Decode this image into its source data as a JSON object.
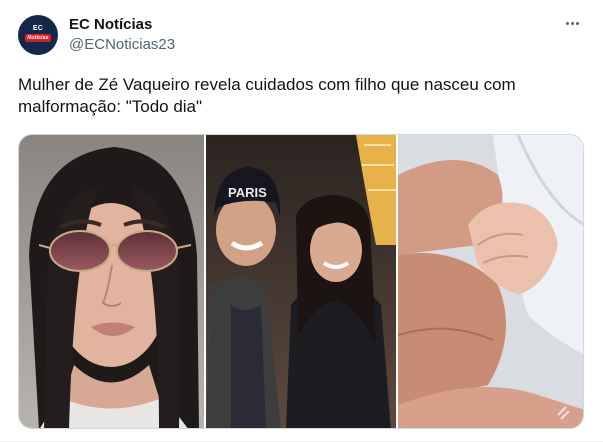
{
  "author": {
    "display_name": "EC Notícias",
    "handle": "@ECNoticias23",
    "avatar_text_top": "EC",
    "avatar_text_badge": "Notícias"
  },
  "menu": {
    "icon": "more-horizontal-icon"
  },
  "tweet": {
    "text": "Mulher de Zé Vaqueiro revela cuidados com filho que nasceu com malformação: \"Todo dia\""
  },
  "media": {
    "photos": [
      {
        "name": "woman-sunglasses-selfie"
      },
      {
        "name": "couple-eiffel-tower",
        "cap_text": "PARIS"
      },
      {
        "name": "baby-hand-holding-adult-finger"
      }
    ]
  },
  "colors": {
    "text_primary": "#0f1419",
    "text_secondary": "#536471",
    "avatar_bg": "#14284a",
    "badge_red": "#d81f26"
  }
}
